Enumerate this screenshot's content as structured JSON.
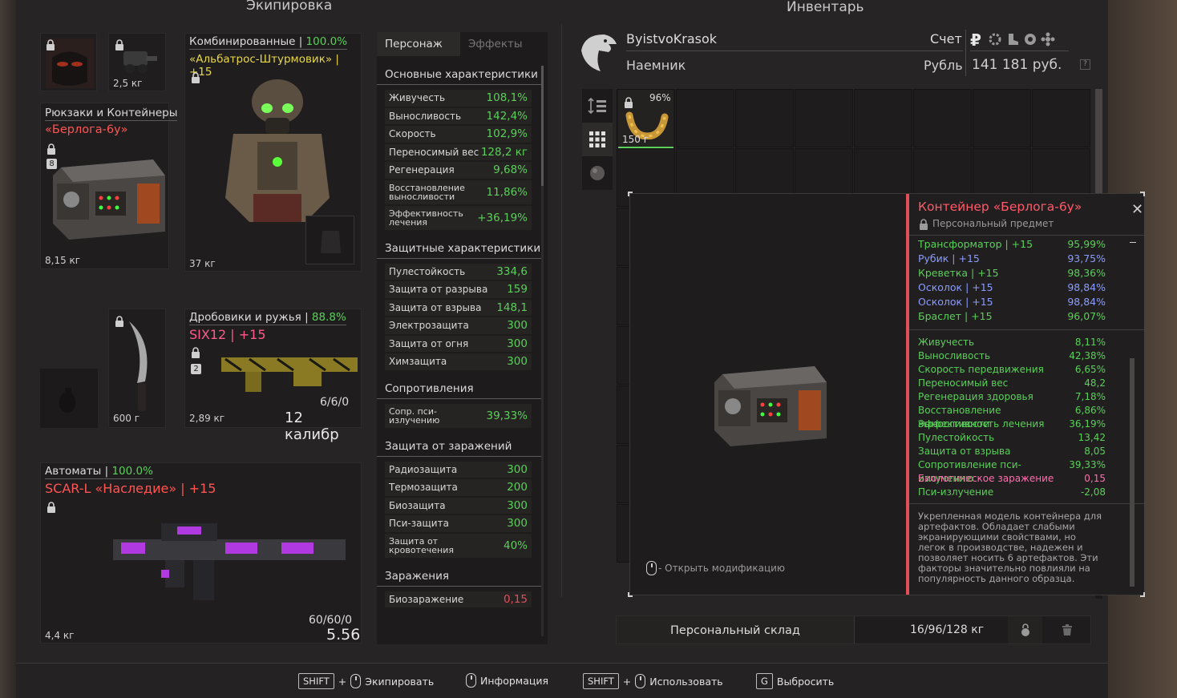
{
  "left_title": "Экипировка",
  "right_title": "Инвентарь",
  "equipment": {
    "backpack": {
      "category": "Рюкзаки и Контейнеры",
      "name": "«Берлога-6у»",
      "slots": "8",
      "weight": "8,15 кг"
    },
    "goggles": {
      "weight": "2,5 кг"
    },
    "armor": {
      "category": "Комбинированные",
      "percent": "100.0%",
      "name": "«Альбатрос-Штурмовик» | +15",
      "weight": "37 кг"
    },
    "melee": {
      "weight": "600 г"
    },
    "shotgun": {
      "category": "Дробовики и ружья",
      "percent": "88.8%",
      "name": "SIX12 | +15",
      "slots": "2",
      "ammo": "6/6/0",
      "weight": "2,89 кг",
      "caliber": "12 калибр"
    },
    "rifle": {
      "category": "Автоматы",
      "percent": "100.0%",
      "name": "SCAR-L «Наследие» | +15",
      "ammo": "60/60/0",
      "weight": "4,4 кг",
      "caliber": "5.56"
    }
  },
  "stats_panel": {
    "tabs": [
      "Персонаж",
      "Эффекты"
    ],
    "sections": [
      {
        "title": "Основные характеристики",
        "rows": [
          {
            "label": "Живучесть",
            "value": "108,1%"
          },
          {
            "label": "Выносливость",
            "value": "142,4%"
          },
          {
            "label": "Скорость",
            "value": "102,9%"
          },
          {
            "label": "Переносимый вес",
            "value": "128,2 кг"
          },
          {
            "label": "Регенерация",
            "value": "9,68%"
          },
          {
            "label": "Восстановление выносливости",
            "value": "11,86%",
            "tall": true
          },
          {
            "label": "Эффективность лечения",
            "value": "+36,19%",
            "tall": true
          }
        ]
      },
      {
        "title": "Защитные характеристики",
        "rows": [
          {
            "label": "Пулестойкость",
            "value": "334,6"
          },
          {
            "label": "Защита от разрыва",
            "value": "159"
          },
          {
            "label": "Защита от взрыва",
            "value": "148,1"
          },
          {
            "label": "Электрозащита",
            "value": "300"
          },
          {
            "label": "Защита от огня",
            "value": "300"
          },
          {
            "label": "Химзащита",
            "value": "300"
          }
        ]
      },
      {
        "title": "Сопротивления",
        "rows": [
          {
            "label": "Сопр. пси-излучению",
            "value": "39,33%",
            "tall": true
          }
        ]
      },
      {
        "title": "Защита от заражений",
        "rows": [
          {
            "label": "Радиозащита",
            "value": "300"
          },
          {
            "label": "Термозащита",
            "value": "200"
          },
          {
            "label": "Биозащита",
            "value": "300"
          },
          {
            "label": "Пси-защита",
            "value": "300"
          },
          {
            "label": "Защита от кровотечения",
            "value": "40%",
            "tall": true
          }
        ]
      },
      {
        "title": "Заражения",
        "rows": [
          {
            "label": "Биозаражение",
            "value": "0,15",
            "color": "red"
          }
        ]
      }
    ]
  },
  "player": {
    "name": "ByistvoKrasok",
    "role": "Наемник",
    "account_label": "Счет",
    "currency_symbol": "₽",
    "currency_label": "Рубль",
    "money": "141 181 руб.",
    "help": "?"
  },
  "inventory_item": {
    "durability": "96%",
    "weight": "150 г"
  },
  "popup": {
    "title": "Контейнер «Берлога-6у»",
    "subtitle": "Персональный предмет",
    "artifacts": [
      {
        "name": "Трансформатор | +15",
        "value": "95,99%",
        "color": "green"
      },
      {
        "name": "Рубик | +15",
        "value": "93,75%",
        "color": "blue"
      },
      {
        "name": "Креветка | +15",
        "value": "98,36%",
        "color": "green"
      },
      {
        "name": "Осколок | +15",
        "value": "98,84%",
        "color": "blue"
      },
      {
        "name": "Осколок | +15",
        "value": "98,84%",
        "color": "blue"
      },
      {
        "name": "Браслет | +15",
        "value": "96,07%",
        "color": "green"
      }
    ],
    "effects": [
      {
        "name": "Живучесть",
        "value": "8,11%",
        "color": "green"
      },
      {
        "name": "Выносливость",
        "value": "42,38%",
        "color": "green"
      },
      {
        "name": "Скорость передвижения",
        "value": "6,65%",
        "color": "green"
      },
      {
        "name": "Переносимый вес",
        "value": "48,2",
        "color": "green"
      },
      {
        "name": "Регенерация здоровья",
        "value": "7,18%",
        "color": "green"
      },
      {
        "name": "Восстановление выносливости",
        "value": "6,86%",
        "color": "green"
      },
      {
        "name": "Эффективность лечения",
        "value": "36,19%",
        "color": "green"
      },
      {
        "name": "Пулестойкость",
        "value": "13,42",
        "color": "green"
      },
      {
        "name": "Защита от взрыва",
        "value": "8,05",
        "color": "green"
      },
      {
        "name": "Сопротивление пси-излучению",
        "value": "39,33%",
        "color": "green"
      },
      {
        "name": "Биологическое заражение",
        "value": "0,15",
        "color": "pink"
      },
      {
        "name": "Пси-излучение",
        "value": "-2,08",
        "color": "green"
      }
    ],
    "description": "Укрепленная модель контейнера для артефактов. Обладает слабыми экранирующими свойствами, но легок в производстве, надежен и позволяет носить 6 артефактов. Эти факторы значительно повлияли на популярность данного образца.",
    "open_mod": "- Открыть модификацию"
  },
  "storage": {
    "label": "Персональный склад",
    "weight": "16/96/128 кг"
  },
  "footer": {
    "shift": "SHIFT",
    "plus": "+",
    "equip": "Экипировать",
    "info": "Информация",
    "use": "Использовать",
    "g_key": "G",
    "drop": "Выбросить"
  },
  "colors": {
    "accent_red": "#e0505a",
    "green": "#5ad05a",
    "yellow": "#e8d84a",
    "pink": "#ff6fae",
    "blue": "#8a9cff"
  }
}
